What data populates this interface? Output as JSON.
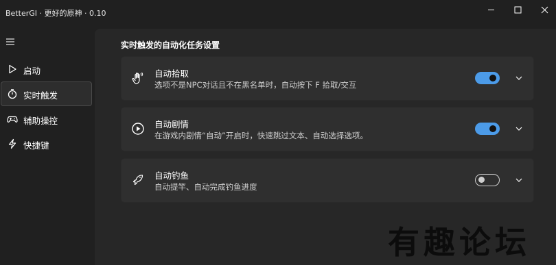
{
  "window": {
    "title": "BetterGI · 更好的原神 · 0.10",
    "controls": [
      "minimize-icon",
      "maximize-icon",
      "close-icon"
    ]
  },
  "sidebar": {
    "menu_icon": "hamburger-icon",
    "items": [
      {
        "label": "启动",
        "icon": "play-outline-icon",
        "active": false
      },
      {
        "label": "实时触发",
        "icon": "timer-icon",
        "active": true
      },
      {
        "label": "辅助操控",
        "icon": "gamepad-icon",
        "active": false
      },
      {
        "label": "快捷键",
        "icon": "flash-icon",
        "active": false
      }
    ]
  },
  "main": {
    "section_title": "实时触发的自动化任务设置",
    "cards": [
      {
        "title": "自动拾取",
        "description": "选项不是NPC对话且不在黑名单时，自动按下 F 拾取/交互",
        "icon": "hand-icon",
        "enabled": true
      },
      {
        "title": "自动剧情",
        "description": "在游戏内剧情“自动”开启时，快速跳过文本、自动选择选项。",
        "icon": "play-circle-icon",
        "enabled": true
      },
      {
        "title": "自动钓鱼",
        "description": "自动提竿、自动完成钓鱼进度",
        "icon": "fish-icon",
        "enabled": false
      }
    ]
  },
  "watermark": "有趣论坛",
  "colors": {
    "accent": "#4c9be8",
    "card_bg": "#2f2f2f",
    "content_bg": "#272727",
    "window_bg": "#202020"
  }
}
